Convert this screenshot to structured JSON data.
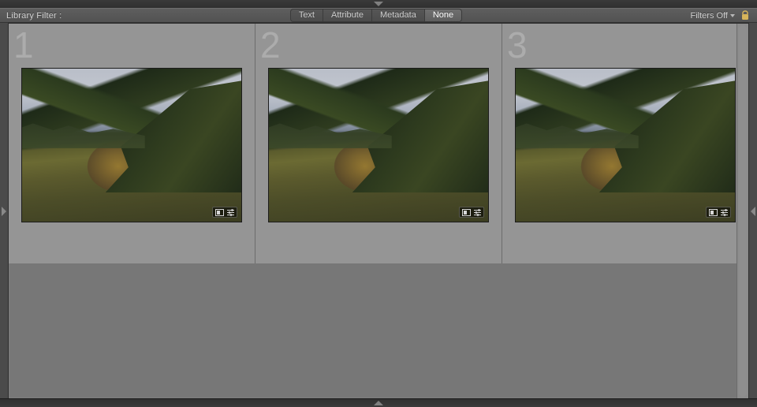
{
  "filter_bar": {
    "title": "Library Filter :",
    "segments": [
      "Text",
      "Attribute",
      "Metadata",
      "None"
    ],
    "active_segment": "None",
    "filters_off_label": "Filters Off"
  },
  "icons": {
    "lock": "lock-icon",
    "chevron_down": "chevron-down-icon",
    "panel_top": "collapse-top-icon",
    "panel_bottom": "collapse-bottom-icon",
    "panel_left": "expand-left-icon",
    "panel_right": "expand-right-icon",
    "thumb_badge_auto": "auto-tone-icon",
    "thumb_badge_dev": "develop-adjust-icon"
  },
  "grid": {
    "cells": [
      {
        "index": "1"
      },
      {
        "index": "2"
      },
      {
        "index": "3"
      }
    ]
  }
}
